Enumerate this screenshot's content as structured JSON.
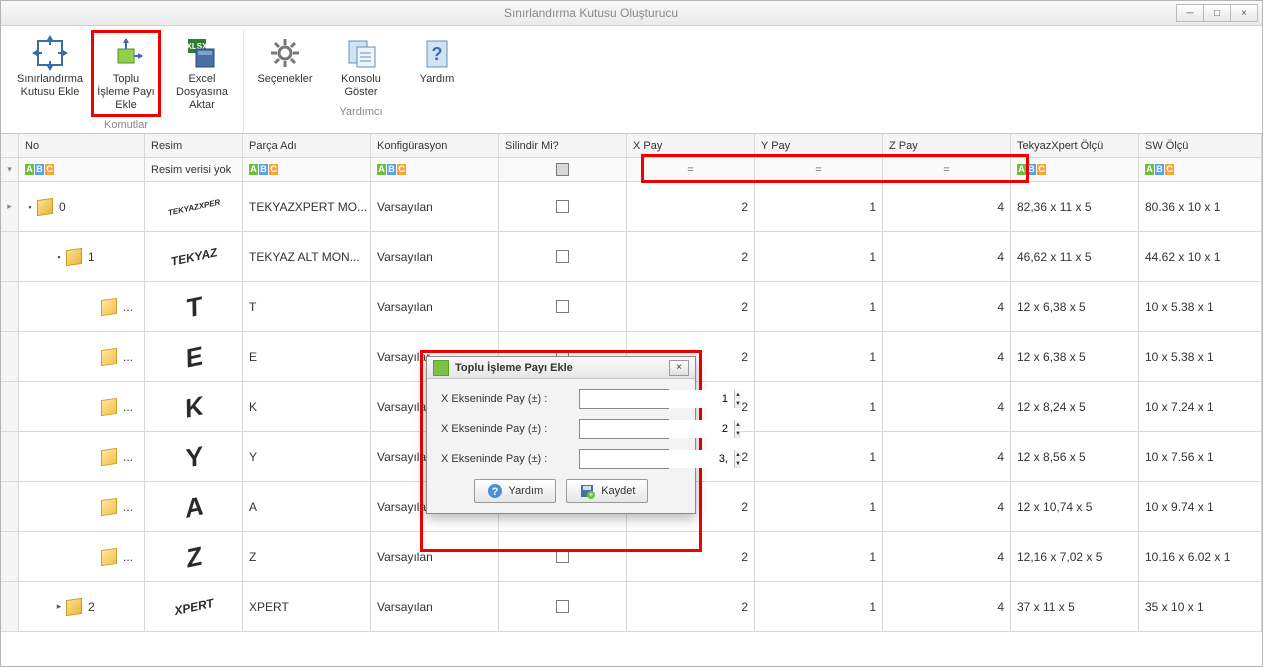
{
  "window": {
    "title": "Sınırlandırma Kutusu Oluşturucu",
    "min_label": "─",
    "max_label": "□",
    "close_label": "×"
  },
  "ribbon": {
    "group1_label": "Komutlar",
    "group2_label": "Yardımcı",
    "btn_bbox_add": "Sınırlandırma Kutusu Ekle",
    "btn_bulk_add": "Toplu İşleme Payı Ekle",
    "btn_excel": "Excel Dosyasına Aktar",
    "btn_options": "Seçenekler",
    "btn_console": "Konsolu Göster",
    "btn_help": "Yardım"
  },
  "columns": {
    "no": "No",
    "resim": "Resim",
    "parca": "Parça Adı",
    "konf": "Konfigürasyon",
    "silindir": "Silindir Mi?",
    "xpay": "X Pay",
    "ypay": "Y Pay",
    "zpay": "Z Pay",
    "tekyaz": "TekyazXpert Ölçü",
    "sw": "SW Ölçü"
  },
  "filter_resim": "Resim verisi yok",
  "rows": [
    {
      "indent": 0,
      "toggle": "▾",
      "icon": "asm",
      "no": "0",
      "thumb": "TEKYAZXPER",
      "thumbsize": "8",
      "parca": "TEKYAZXPERT MO...",
      "konf": "Varsayılan",
      "xpay": "2",
      "ypay": "1",
      "zpay": "4",
      "tx": "82,36 x 11 x 5",
      "sw": "80.36 x 10 x 1"
    },
    {
      "indent": 1,
      "toggle": "▾",
      "icon": "asm",
      "no": "1",
      "thumb": "TEKYAZ",
      "thumbsize": "12",
      "parca": "TEKYAZ ALT MON...",
      "konf": "Varsayılan",
      "xpay": "2",
      "ypay": "1",
      "zpay": "4",
      "tx": "46,62 x 11 x 5",
      "sw": "44.62 x 10 x 1"
    },
    {
      "indent": 2,
      "toggle": "",
      "icon": "part",
      "no": "...",
      "thumb": "T",
      "thumbsize": "26",
      "parca": "T",
      "konf": "Varsayılan",
      "xpay": "2",
      "ypay": "1",
      "zpay": "4",
      "tx": "12 x 6,38 x 5",
      "sw": "10 x 5.38 x 1"
    },
    {
      "indent": 2,
      "toggle": "",
      "icon": "part",
      "no": "...",
      "thumb": "E",
      "thumbsize": "26",
      "parca": "E",
      "konf": "Varsayılar",
      "xpay": "2",
      "ypay": "1",
      "zpay": "4",
      "tx": "12 x 6,38 x 5",
      "sw": "10 x 5.38 x 1"
    },
    {
      "indent": 2,
      "toggle": "",
      "icon": "part",
      "no": "...",
      "thumb": "K",
      "thumbsize": "26",
      "parca": "K",
      "konf": "Varsayılar",
      "xpay": "2",
      "ypay": "1",
      "zpay": "4",
      "tx": "12 x 8,24 x 5",
      "sw": "10 x 7.24 x 1"
    },
    {
      "indent": 2,
      "toggle": "",
      "icon": "part",
      "no": "...",
      "thumb": "Y",
      "thumbsize": "26",
      "parca": "Y",
      "konf": "Varsayılar",
      "xpay": "2",
      "ypay": "1",
      "zpay": "4",
      "tx": "12 x 8,56 x 5",
      "sw": "10 x 7.56 x 1"
    },
    {
      "indent": 2,
      "toggle": "",
      "icon": "part",
      "no": "...",
      "thumb": "A",
      "thumbsize": "26",
      "parca": "A",
      "konf": "Varsayılar",
      "xpay": "2",
      "ypay": "1",
      "zpay": "4",
      "tx": "12 x 10,74 x 5",
      "sw": "10 x 9.74 x 1"
    },
    {
      "indent": 2,
      "toggle": "",
      "icon": "part",
      "no": "...",
      "thumb": "Z",
      "thumbsize": "26",
      "parca": "Z",
      "konf": "Varsayılan",
      "xpay": "2",
      "ypay": "1",
      "zpay": "4",
      "tx": "12,16 x 7,02 x 5",
      "sw": "10.16 x 6.02 x 1"
    },
    {
      "indent": 1,
      "toggle": "▸",
      "icon": "asm",
      "no": "2",
      "thumb": "XPERT",
      "thumbsize": "12",
      "parca": "XPERT",
      "konf": "Varsayılan",
      "xpay": "2",
      "ypay": "1",
      "zpay": "4",
      "tx": "37 x 11 x 5",
      "sw": "35 x 10 x 1"
    }
  ],
  "dialog": {
    "title": "Toplu İşleme Payı Ekle",
    "field_x": "X Ekseninde Pay (±) :",
    "field_y": "X Ekseninde Pay (±) :",
    "field_z": "X Ekseninde Pay (±) :",
    "val_x": "1",
    "val_y": "2",
    "val_z": "3,",
    "btn_help": "Yardım",
    "btn_save": "Kaydet",
    "close": "×"
  }
}
